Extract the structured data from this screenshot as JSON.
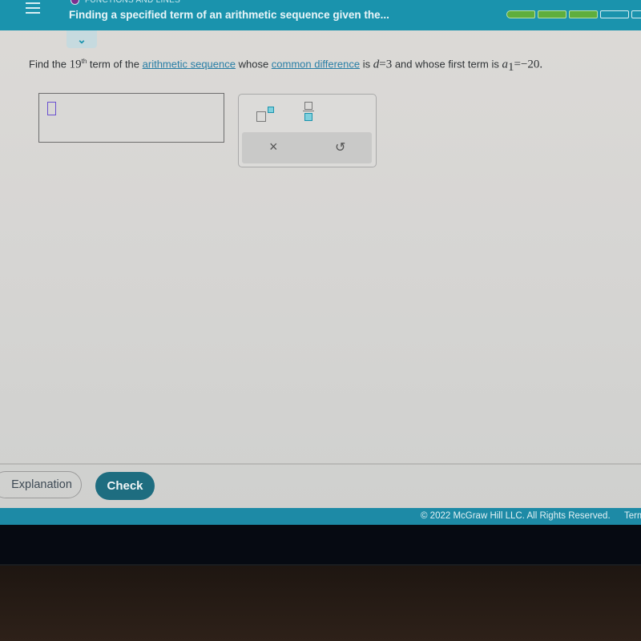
{
  "header": {
    "category": "FUNCTIONS AND LINES",
    "title": "Finding a specified term of an arithmetic sequence given the...",
    "progress": {
      "completed_segments": 3,
      "visible_segments": 5
    },
    "collapse_icon": "chevron-down-icon",
    "menu_icon": "hamburger-menu-icon"
  },
  "question": {
    "part1": "Find the ",
    "term_number": "19",
    "term_suffix": "th",
    "part2": " term of the ",
    "link1": "arithmetic sequence",
    "part3": " whose ",
    "link2": "common difference",
    "part4": " is ",
    "d_var": "d",
    "d_eq": "=3",
    "part5": " and whose first term is ",
    "a_var": "a",
    "a_sub": "1",
    "a_eq": "=−20."
  },
  "answer": {
    "value": ""
  },
  "keypad": {
    "exponent_icon": "superscript-icon",
    "fraction_icon": "fraction-icon",
    "clear_label": "×",
    "undo_label": "↺"
  },
  "actions": {
    "explanation_label": "Explanation",
    "check_label": "Check"
  },
  "footer": {
    "copyright": "© 2022 McGraw Hill LLC. All Rights Reserved.",
    "terms": "Terms"
  }
}
